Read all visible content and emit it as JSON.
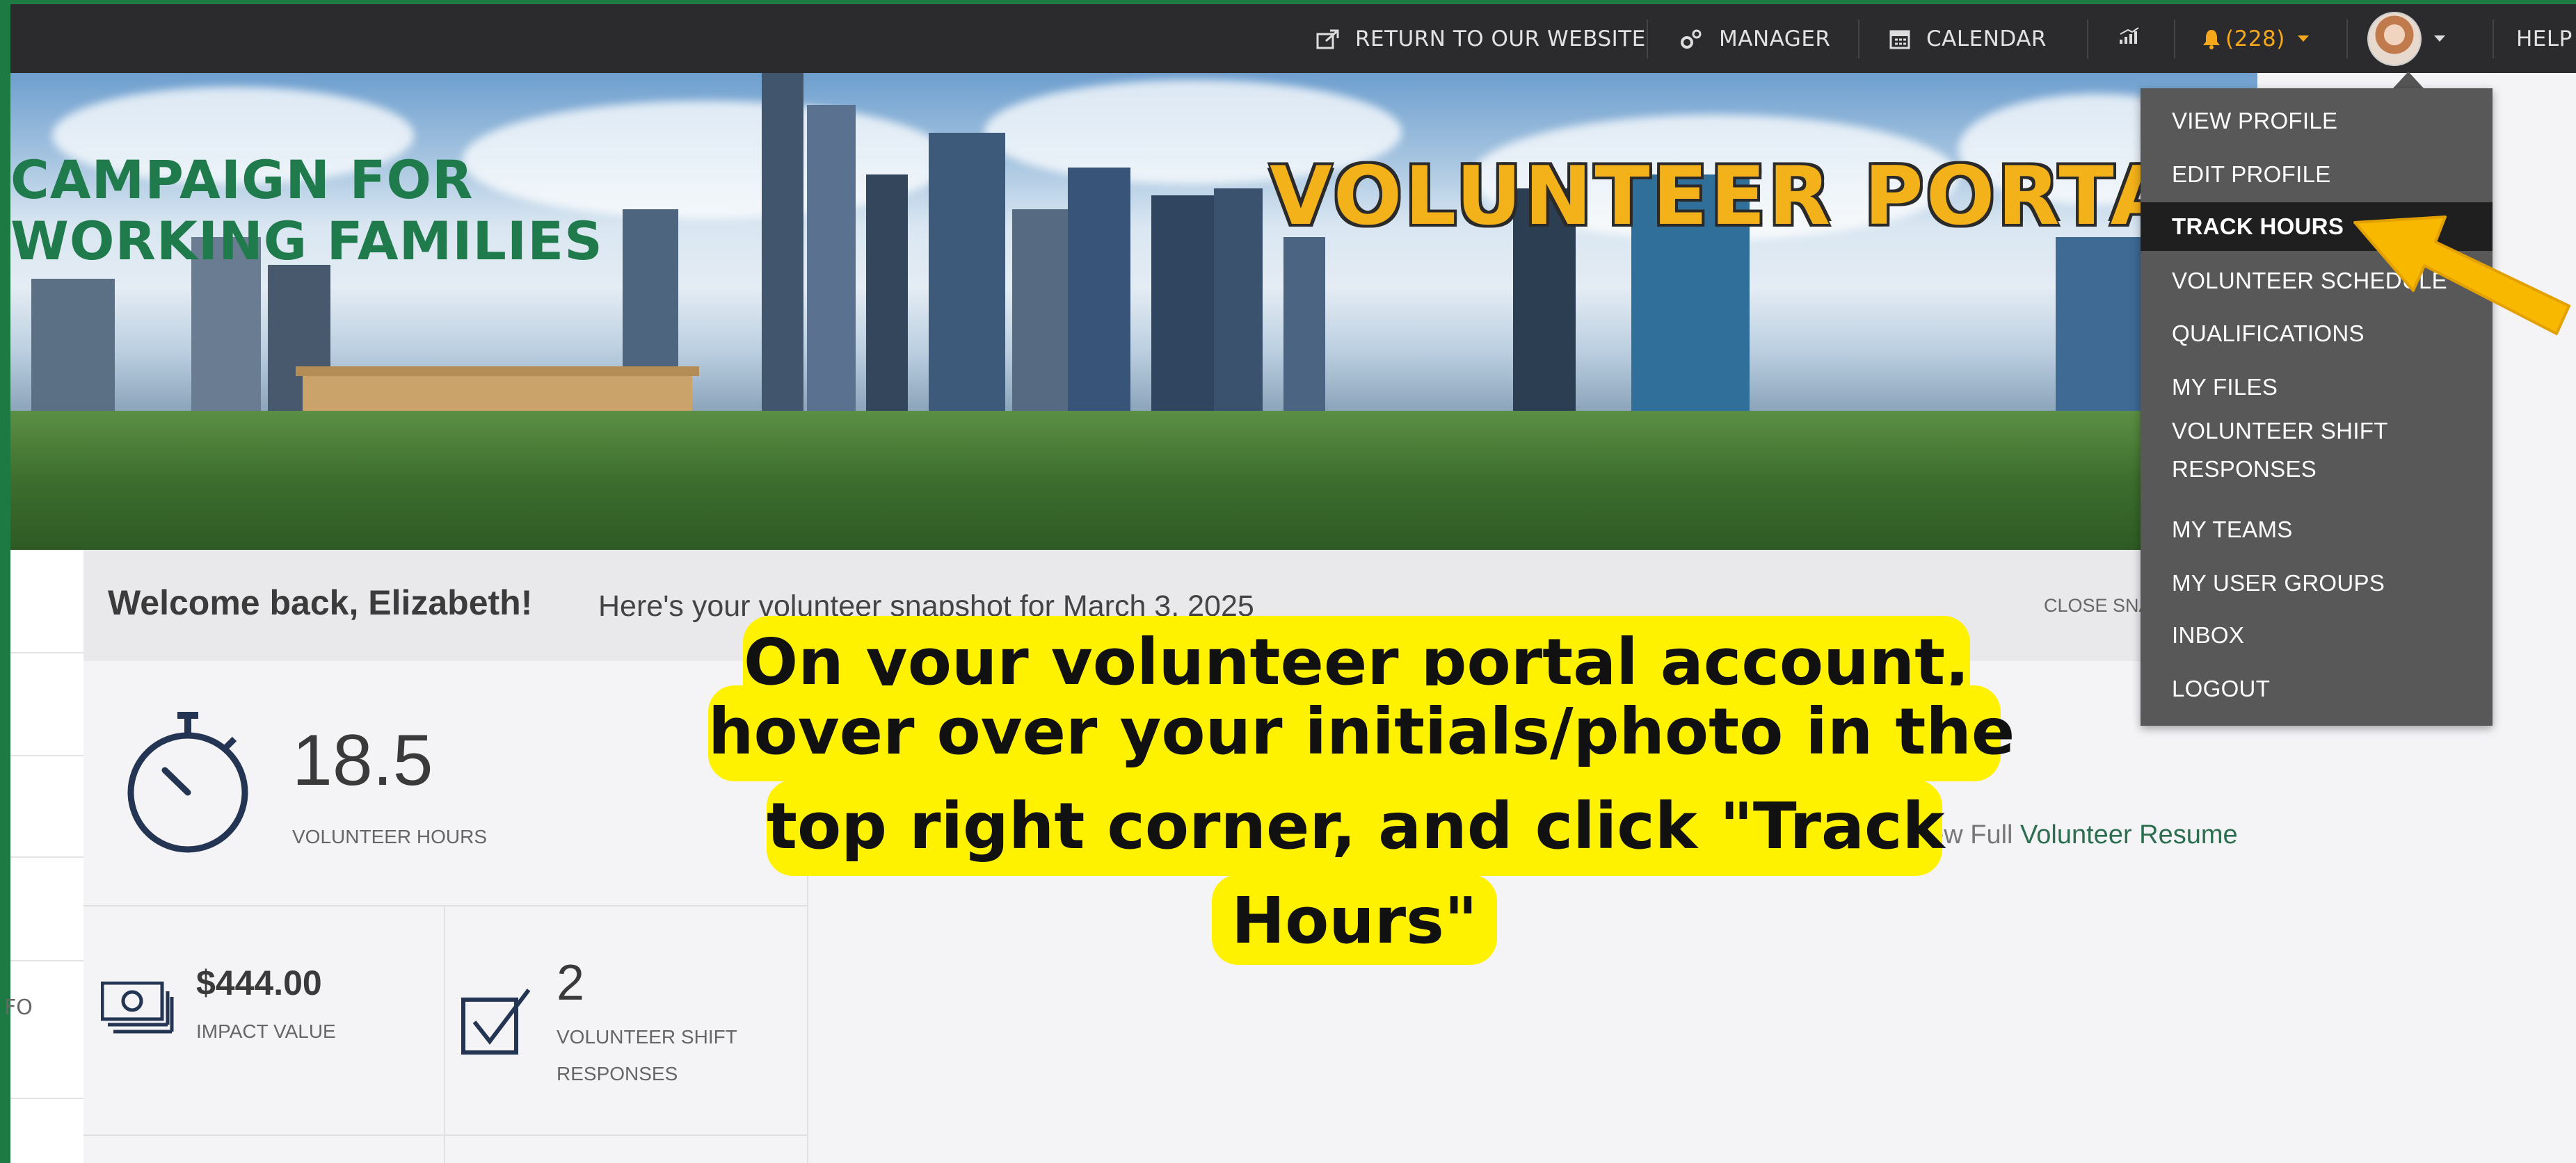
{
  "nav": {
    "return_label": "RETURN TO OUR WEBSITE",
    "manager_label": "MANAGER",
    "calendar_label": "CALENDAR",
    "notifications_count": "(228)",
    "help_label": "HELP"
  },
  "banner": {
    "org_line1": "CAMPAIGN FOR",
    "org_line2": "WORKING FAMILIES",
    "portal_title": "VOLUNTEER PORTAL"
  },
  "welcome": {
    "title": "Welcome back, Elizabeth!",
    "subtitle": "Here's your volunteer snapshot for March 3, 2025",
    "close_label": "CLOSE SNAPSHOT"
  },
  "stats": {
    "hours_value": "18.5",
    "hours_label": "VOLUNTEER HOURS",
    "impact_value": "$444.00",
    "impact_label": "IMPACT VALUE",
    "shift_value": "2",
    "shift_label": "VOLUNTEER SHIFT RESPONSES"
  },
  "resume": {
    "prefix": "View Full ",
    "link": "Volunteer Resume"
  },
  "sidebar": {
    "partial_text": "FO"
  },
  "user_menu": {
    "items": [
      "VIEW PROFILE",
      "EDIT PROFILE",
      "TRACK HOURS",
      "VOLUNTEER SCHEDULE",
      "QUALIFICATIONS",
      "MY FILES",
      "VOLUNTEER SHIFT RESPONSES",
      "MY TEAMS",
      "MY USER GROUPS",
      "INBOX",
      "LOGOUT"
    ],
    "active_item": "TRACK HOURS"
  },
  "callout": {
    "line1": "On your volunteer portal account,",
    "line2": "hover over your initials/photo in the",
    "line3": "top right corner, and click \"Track",
    "line4": "Hours\""
  },
  "colors": {
    "accent_green": "#1e7a43",
    "title_gold": "#f3b21a",
    "notification_orange": "#f6a81d",
    "callout_yellow": "#fff200",
    "arrow_yellow": "#f9b800"
  }
}
